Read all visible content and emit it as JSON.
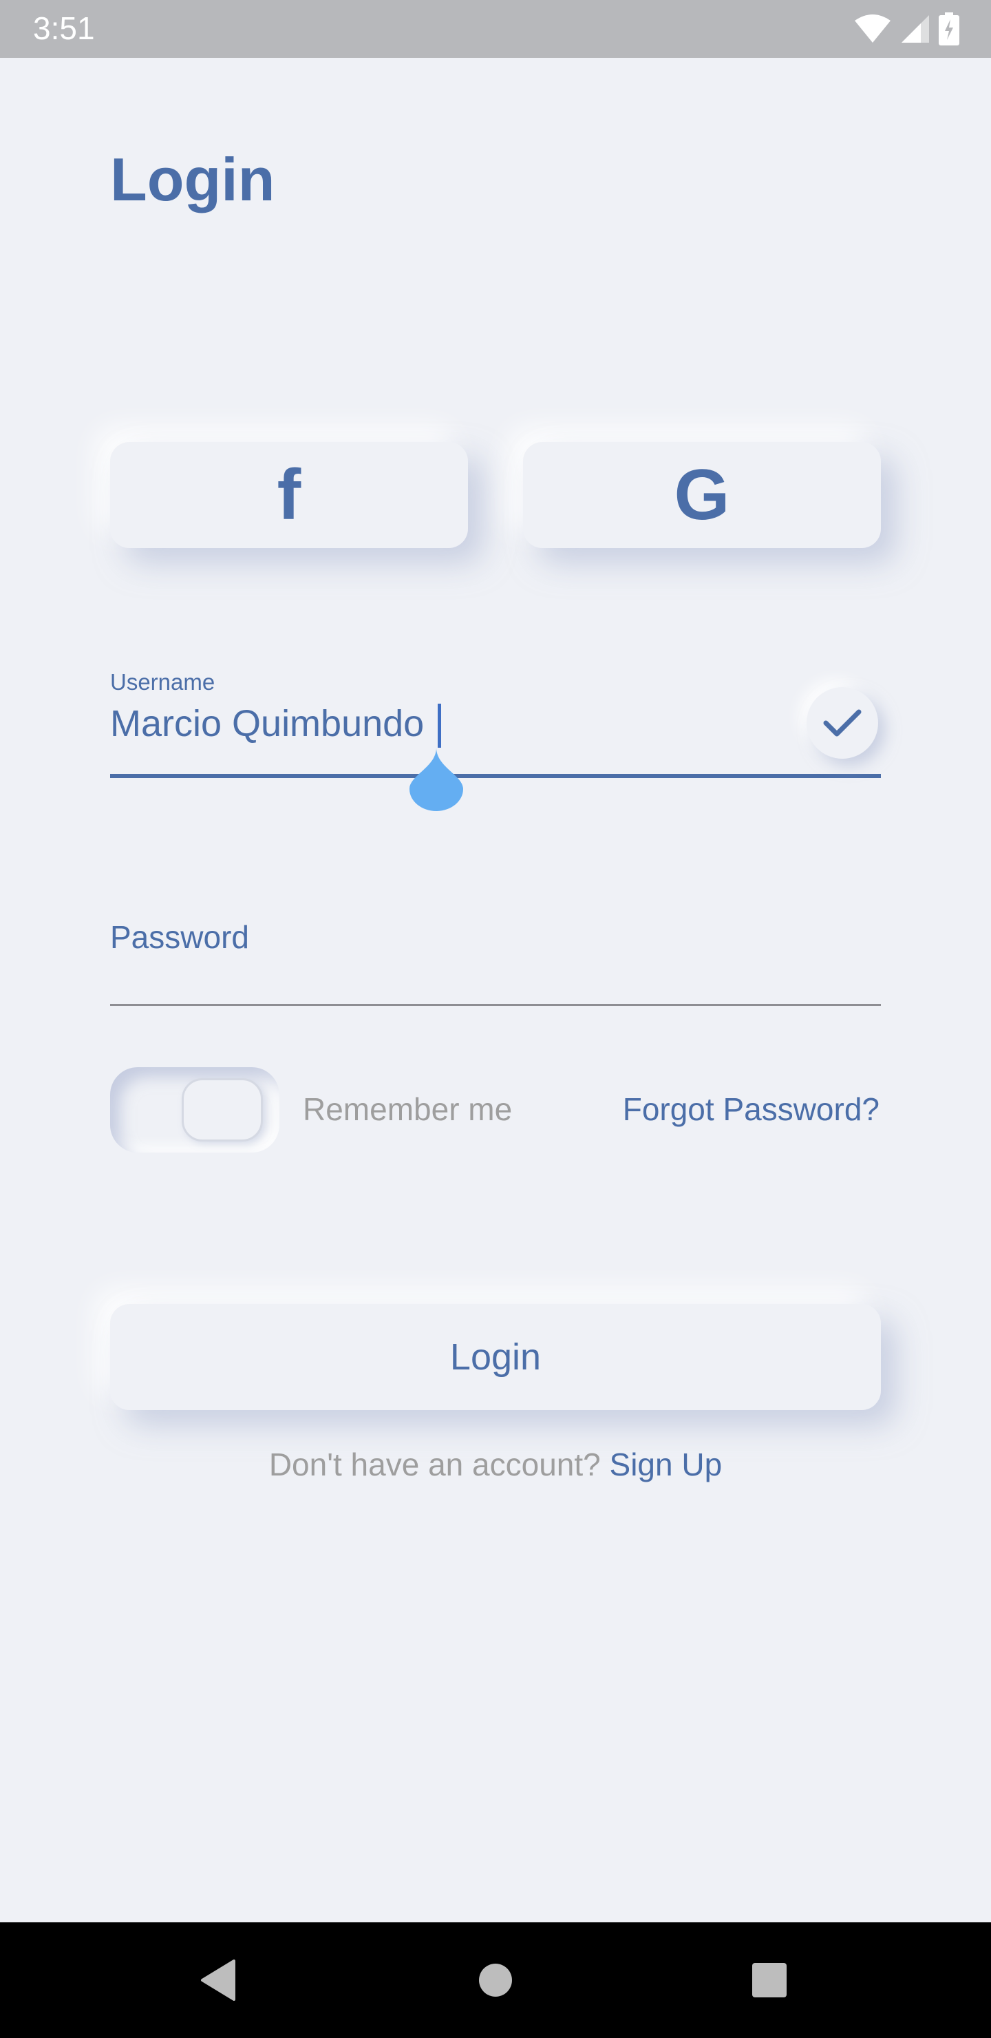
{
  "status_bar": {
    "time": "3:51",
    "icons": [
      "wifi-icon",
      "signal-icon",
      "battery-icon"
    ]
  },
  "page": {
    "title": "Login"
  },
  "social": {
    "facebook_glyph": "f",
    "google_glyph": "G"
  },
  "username": {
    "label": "Username",
    "value": "Marcio Quimbundo",
    "valid_icon": "check-icon"
  },
  "password": {
    "placeholder": "Password"
  },
  "options": {
    "remember_label": "Remember me",
    "remember_checked": false,
    "forgot_label": "Forgot Password?"
  },
  "actions": {
    "login_label": "Login",
    "signup_prompt": "Don't have an account? ",
    "signup_link": "Sign Up"
  },
  "colors": {
    "accent": "#4b6ea8",
    "background": "#eff1f6",
    "muted_text": "#9e9e9e",
    "handle": "#64aef2"
  },
  "nav_bar": {
    "icons": [
      "back-icon",
      "home-icon",
      "recents-icon"
    ]
  }
}
